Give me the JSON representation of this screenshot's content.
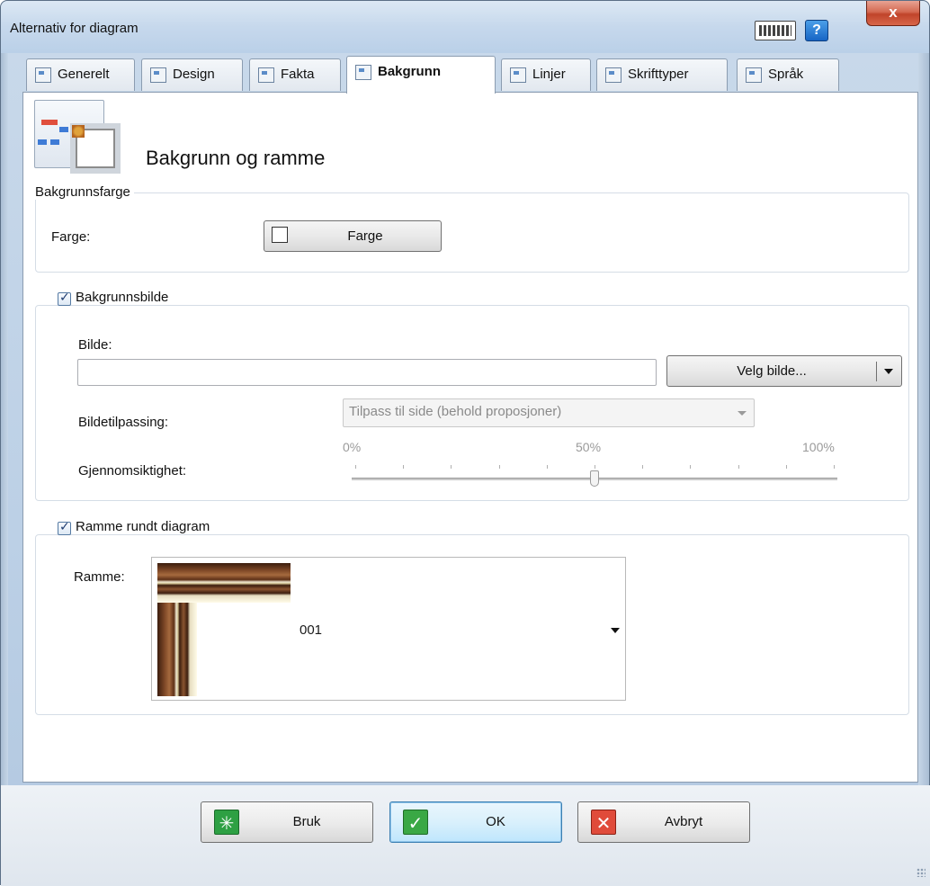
{
  "window": {
    "title": "Alternativ for diagram",
    "close_label": "x",
    "help_label": "?"
  },
  "tabs": [
    {
      "label": "Generelt",
      "icon": "gear-doc-icon"
    },
    {
      "label": "Design",
      "icon": "magnifier-doc-icon"
    },
    {
      "label": "Fakta",
      "icon": "clock-doc-icon"
    },
    {
      "label": "Bakgrunn",
      "icon": "background-doc-icon",
      "active": true
    },
    {
      "label": "Linjer",
      "icon": "lines-doc-icon"
    },
    {
      "label": "Skrifttyper",
      "icon": "font-doc-icon"
    },
    {
      "label": "Språk",
      "icon": "language-doc-icon"
    }
  ],
  "page": {
    "title": "Bakgrunn og ramme"
  },
  "background_color": {
    "legend": "Bakgrunnsfarge",
    "label": "Farge:",
    "button_label": "Farge",
    "swatch_color": "#ffffff"
  },
  "background_image": {
    "legend": "Bakgrunnsbilde",
    "checked": true,
    "image_label": "Bilde:",
    "image_value": "",
    "choose_button_label": "Velg bilde...",
    "fit_label": "Bildetilpassing:",
    "fit_value": "Tilpass til side (behold proposjoner)",
    "transparency_label": "Gjennomsiktighet:",
    "ticks": [
      "0%",
      "50%",
      "100%"
    ],
    "transparency_percent": 50
  },
  "frame": {
    "legend": "Ramme rundt diagram",
    "checked": true,
    "label": "Ramme:",
    "selected_value": "001"
  },
  "footer": {
    "apply_label": "Bruk",
    "ok_label": "OK",
    "cancel_label": "Avbryt"
  }
}
